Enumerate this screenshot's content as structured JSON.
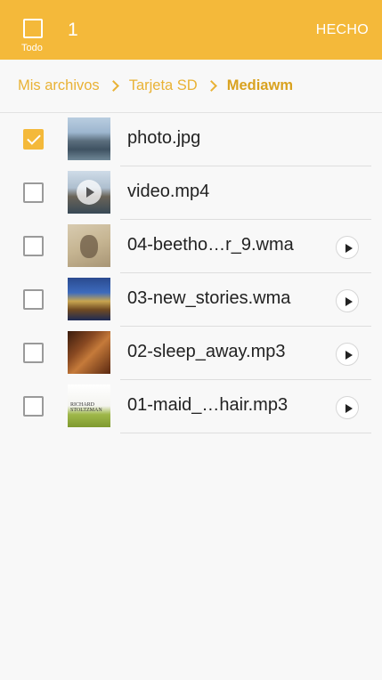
{
  "topbar": {
    "all_label": "Todo",
    "selected_count": "1",
    "done_label": "HECHO"
  },
  "breadcrumb": [
    "Mis archivos",
    "Tarjeta SD",
    "Mediawm"
  ],
  "files": [
    {
      "name": "photo.jpg",
      "checked": true,
      "thumb_icon": "photo-thumbnail"
    },
    {
      "name": "video.mp4",
      "checked": false,
      "thumb_icon": "video-thumbnail"
    },
    {
      "name": "04-beetho…r_9.wma",
      "checked": false,
      "thumb_icon": "album-art-thumbnail"
    },
    {
      "name": "03-new_stories.wma",
      "checked": false,
      "thumb_icon": "album-art-thumbnail"
    },
    {
      "name": "02-sleep_away.mp3",
      "checked": false,
      "thumb_icon": "album-art-thumbnail"
    },
    {
      "name": "01-maid_…hair.mp3",
      "checked": false,
      "thumb_icon": "album-art-thumbnail",
      "thumb_text": "RICHARD STOLTZMAN"
    }
  ],
  "colors": {
    "accent": "#f4b93a",
    "breadcrumb": "#e9b235"
  }
}
